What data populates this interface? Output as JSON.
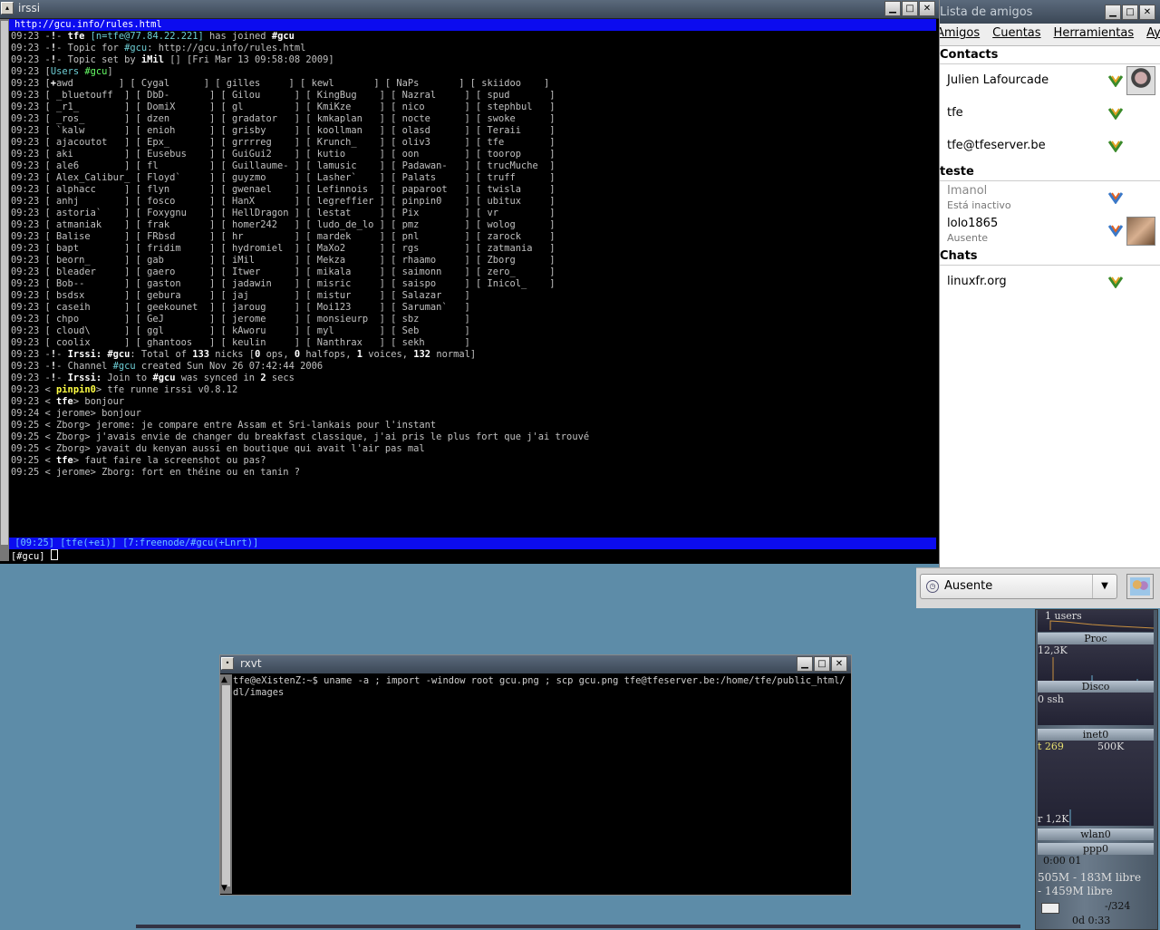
{
  "irssi": {
    "title": "irssi",
    "topic_bar": "http://gcu.info/rules.html",
    "lines": [
      [
        [
          "09:23 ",
          "g"
        ],
        [
          "-",
          "g"
        ],
        [
          "!",
          "w"
        ],
        [
          "- ",
          "g"
        ],
        [
          "tfe ",
          "w"
        ],
        [
          "[n=tfe@77.84.22.221] ",
          "c"
        ],
        [
          "has joined ",
          "g"
        ],
        [
          "#gcu",
          "w"
        ]
      ],
      [
        [
          "09:23 ",
          "g"
        ],
        [
          "-",
          "g"
        ],
        [
          "!",
          "w"
        ],
        [
          "- Topic for ",
          "g"
        ],
        [
          "#gcu",
          "c"
        ],
        [
          ": http://gcu.info/rules.html",
          "g"
        ]
      ],
      [
        [
          "09:23 ",
          "g"
        ],
        [
          "-",
          "g"
        ],
        [
          "!",
          "w"
        ],
        [
          "- Topic set by ",
          "g"
        ],
        [
          "iMil ",
          "w"
        ],
        [
          "[] [Fri Mar 13 09:58:08 2009]",
          "g"
        ]
      ],
      [
        [
          "09:23 ",
          "g"
        ],
        [
          "[",
          "g"
        ],
        [
          "Users ",
          "c"
        ],
        [
          "#gcu",
          "gr"
        ],
        [
          "]",
          "g"
        ]
      ],
      [
        [
          "09:23 [",
          "g"
        ],
        [
          "+",
          "w"
        ],
        [
          "awd        ] [ Cygal      ] [ gilles     ] [ kewl       ] [ NaPs       ] [ skiidoo    ]",
          "g"
        ]
      ],
      [
        [
          "09:23 [ _bluetouff  ] [ DbD-       ] [ Gilou      ] [ KingBug    ] [ Nazral     ] [ spud       ]",
          "g"
        ]
      ],
      [
        [
          "09:23 [ _r1_        ] [ DomiX      ] [ gl         ] [ KmiKze     ] [ nico       ] [ stephbul   ]",
          "g"
        ]
      ],
      [
        [
          "09:23 [ _ros_       ] [ dzen       ] [ gradator   ] [ kmkaplan   ] [ nocte      ] [ swoke      ]",
          "g"
        ]
      ],
      [
        [
          "09:23 [ `kalw       ] [ enioh      ] [ grisby     ] [ koollman   ] [ olasd      ] [ Teraii     ]",
          "g"
        ]
      ],
      [
        [
          "09:23 [ ajacoutot   ] [ Epx_       ] [ grrrreg    ] [ Krunch_    ] [ oliv3      ] [ tfe        ]",
          "g"
        ]
      ],
      [
        [
          "09:23 [ aki         ] [ Eusebus    ] [ GuiGui2    ] [ kutio      ] [ oon        ] [ toorop     ]",
          "g"
        ]
      ],
      [
        [
          "09:23 [ ale6        ] [ fl         ] [ Guillaume- ] [ lamusic    ] [ Padawan-   ] [ trucMuche  ]",
          "g"
        ]
      ],
      [
        [
          "09:23 [ Alex_Calibur_ [ Floyd`     ] [ guyzmo     ] [ Lasher`    ] [ Palats     ] [ truff      ]",
          "g"
        ]
      ],
      [
        [
          "09:23 [ alphacc     ] [ flyn       ] [ gwenael    ] [ Lefinnois  ] [ paparoot   ] [ twisla     ]",
          "g"
        ]
      ],
      [
        [
          "09:23 [ anhj        ] [ fosco      ] [ HanX       ] [ legreffier ] [ pinpin0    ] [ ubitux     ]",
          "g"
        ]
      ],
      [
        [
          "09:23 [ astoria`    ] [ Foxygnu    ] [ HellDragon ] [ lestat     ] [ Pix        ] [ vr         ]",
          "g"
        ]
      ],
      [
        [
          "09:23 [ atmaniak    ] [ frak       ] [ homer242   ] [ ludo_de_lo ] [ pmz        ] [ wolog      ]",
          "g"
        ]
      ],
      [
        [
          "09:23 [ Balise      ] [ FRbsd      ] [ hr         ] [ mardek     ] [ pnl        ] [ zarock     ]",
          "g"
        ]
      ],
      [
        [
          "09:23 [ bapt        ] [ fridim     ] [ hydromiel  ] [ MaXo2      ] [ rgs        ] [ zatmania   ]",
          "g"
        ]
      ],
      [
        [
          "09:23 [ beorn_      ] [ gab        ] [ iMil       ] [ Mekza      ] [ rhaamo     ] [ Zborg      ]",
          "g"
        ]
      ],
      [
        [
          "09:23 [ bleader     ] [ gaero      ] [ Itwer      ] [ mikala     ] [ saimonn    ] [ zero_      ]",
          "g"
        ]
      ],
      [
        [
          "09:23 [ Bob--       ] [ gaston     ] [ jadawin    ] [ misric     ] [ saispo     ] [ Inicol_    ]",
          "g"
        ]
      ],
      [
        [
          "09:23 [ bsdsx       ] [ gebura     ] [ jaj        ] [ mistur     ] [ Salazar    ]",
          "g"
        ]
      ],
      [
        [
          "09:23 [ caseih      ] [ geekounet  ] [ jaroug     ] [ Moi123     ] [ Saruman`   ]",
          "g"
        ]
      ],
      [
        [
          "09:23 [ chpo        ] [ GeJ        ] [ jerome     ] [ monsieurp  ] [ sbz        ]",
          "g"
        ]
      ],
      [
        [
          "09:23 [ cloud\\      ] [ ggl        ] [ kAworu     ] [ myl        ] [ Seb        ]",
          "g"
        ]
      ],
      [
        [
          "09:23 [ coolix      ] [ ghantoos   ] [ keulin     ] [ Nanthrax   ] [ sekh       ]",
          "g"
        ]
      ],
      [
        [
          "09:23 ",
          "g"
        ],
        [
          "-",
          "g"
        ],
        [
          "!",
          "w"
        ],
        [
          "- ",
          "g"
        ],
        [
          "Irssi: ",
          "w"
        ],
        [
          "#gcu",
          "w"
        ],
        [
          ": Total of ",
          "g"
        ],
        [
          "133",
          "w"
        ],
        [
          " nicks [",
          "g"
        ],
        [
          "0",
          "w"
        ],
        [
          " ops, ",
          "g"
        ],
        [
          "0",
          "w"
        ],
        [
          " halfops, ",
          "g"
        ],
        [
          "1",
          "w"
        ],
        [
          " voices, ",
          "g"
        ],
        [
          "132",
          "w"
        ],
        [
          " normal]",
          "g"
        ]
      ],
      [
        [
          "09:23 ",
          "g"
        ],
        [
          "-",
          "g"
        ],
        [
          "!",
          "w"
        ],
        [
          "- Channel ",
          "g"
        ],
        [
          "#gcu",
          "c"
        ],
        [
          " created Sun Nov 26 07:42:44 2006",
          "g"
        ]
      ],
      [
        [
          "09:23 ",
          "g"
        ],
        [
          "-",
          "g"
        ],
        [
          "!",
          "w"
        ],
        [
          "- ",
          "g"
        ],
        [
          "Irssi: ",
          "w"
        ],
        [
          "Join to ",
          "g"
        ],
        [
          "#gcu",
          "w"
        ],
        [
          " was synced in ",
          "g"
        ],
        [
          "2",
          "w"
        ],
        [
          " secs",
          "g"
        ]
      ],
      [
        [
          "09:23 < ",
          "g"
        ],
        [
          "pinpin0",
          "y"
        ],
        [
          "> tfe runne irssi v0.8.12",
          "g"
        ]
      ],
      [
        [
          "09:23 < ",
          "g"
        ],
        [
          "tfe",
          "w"
        ],
        [
          "> bonjour",
          "g"
        ]
      ],
      [
        [
          "09:24 < jerome> bonjour",
          "g"
        ]
      ],
      [
        [
          "09:25 < Zborg> jerome: je compare entre Assam et Sri-lankais pour l'instant",
          "g"
        ]
      ],
      [
        [
          "09:25 < Zborg> j'avais envie de changer du breakfast classique, j'ai pris le plus fort que j'ai trouvé",
          "g"
        ]
      ],
      [
        [
          "09:25 < Zborg> yavait du kenyan aussi en boutique qui avait l'air pas mal",
          "g"
        ]
      ],
      [
        [
          "09:25 < ",
          "g"
        ],
        [
          "tfe",
          "w"
        ],
        [
          "> faut faire la screenshot ou pas?",
          "g"
        ]
      ],
      [
        [
          "09:25 < jerome> Zborg: fort en théine ou en tanin ?",
          "g"
        ]
      ]
    ],
    "status_bar": " [09:25] [tfe(+ei)] [7:freenode/#gcu(+Lnrt)]",
    "prompt": "[#gcu] "
  },
  "pidgin": {
    "title": "Lista de amigos",
    "menu": [
      "Amigos",
      "Cuentas",
      "Herramientas",
      "Ayuda"
    ],
    "groups": [
      {
        "name": "Contacts",
        "buddies": [
          {
            "name": "Julien Lafourcade",
            "sub": "",
            "avatar": true
          },
          {
            "name": "tfe",
            "sub": "",
            "avatar": false
          },
          {
            "name": "tfe@tfeserver.be",
            "sub": "",
            "avatar": false
          }
        ]
      },
      {
        "name": "teste",
        "buddies": [
          {
            "name": "Imanol",
            "sub": "Está inactivo",
            "avatar": false
          },
          {
            "name": "lolo1865",
            "sub": "Ausente",
            "avatar": true
          }
        ]
      },
      {
        "name": "Chats",
        "buddies": [
          {
            "name": "linuxfr.org",
            "sub": "",
            "avatar": false
          }
        ]
      }
    ],
    "status": "Ausente"
  },
  "rxvt": {
    "title": "rxvt",
    "command": "tfe@eXistenZ:~$ uname -a ; import -window root gcu.png ; scp gcu.png tfe@tfeserver.be:/home/tfe/public_html/dl/images"
  },
  "gkrellm": {
    "users": "1 users",
    "proc_label": "Proc",
    "proc_value": "12,3K",
    "disk_label": "Disco",
    "disk_value": "0 ssh",
    "inet_label": "inet0",
    "inet_t": "t 269",
    "inet_scale": "500K",
    "inet_r": "r 1,2K",
    "wlan_label": "wlan0",
    "ppp_label": "ppp0",
    "ppp_time": "0:00 01",
    "mem": "505M - 183M libre",
    "swap": "- 1459M libre",
    "mail": "-/324",
    "uptime": "0d 0:33"
  },
  "colors": {
    "irssi_bar": "#0c0cef",
    "desktop": "#5d8ca8",
    "nick_yellow": "#ffff44",
    "channel_cyan": "#6ecfd6",
    "users_green": "#66ff66"
  }
}
